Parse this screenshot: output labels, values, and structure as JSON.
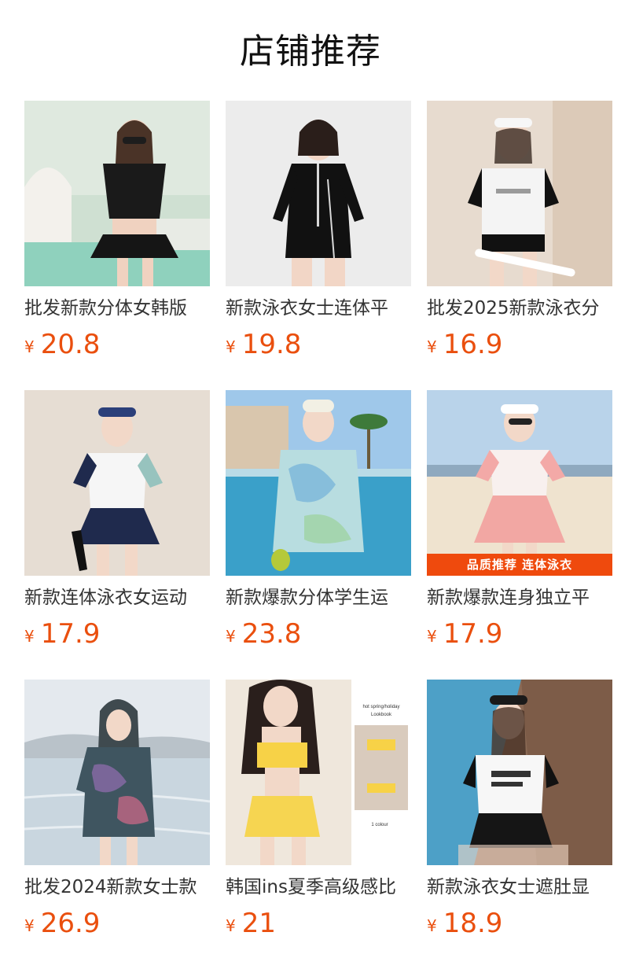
{
  "page": {
    "title": "店铺推荐"
  },
  "colors": {
    "price": "#ea4f0e",
    "badge_bg": "#ef4a0d",
    "title": "#111111",
    "name": "#333333"
  },
  "currency": "¥",
  "products": [
    {
      "name": "批发新款分体女韩版",
      "price": "20.8",
      "image_icon": "swimsuit-photo-black-skirt"
    },
    {
      "name": "新款泳衣女士连体平",
      "price": "19.8",
      "image_icon": "swimsuit-photo-black-zip-longsleeve"
    },
    {
      "name": "批发2025新款泳衣分",
      "price": "16.9",
      "image_icon": "swimsuit-photo-white-black-tee"
    },
    {
      "name": "新款连体泳衣女运动",
      "price": "17.9",
      "image_icon": "swimsuit-photo-navy-dress"
    },
    {
      "name": "新款爆款分体学生运",
      "price": "23.8",
      "image_icon": "swimsuit-photo-blue-print-pool"
    },
    {
      "name": "新款爆款连身独立平",
      "price": "17.9",
      "image_icon": "swimsuit-photo-pink-beach",
      "badge": "品质推荐 连体泳衣"
    },
    {
      "name": "批发2024新款女士款",
      "price": "26.9",
      "image_icon": "swimsuit-photo-floral-hoodie-sea"
    },
    {
      "name": "韩国ins夏季高级感比",
      "price": "21",
      "image_icon": "swimsuit-photo-yellow-bikini",
      "image_text": {
        "line1": "hot spring/holiday",
        "line2": "Lookbook",
        "caption": "1 colour"
      }
    },
    {
      "name": "新款泳衣女士遮肚显",
      "price": "18.9",
      "image_icon": "swimsuit-photo-white-tee-poolside"
    }
  ]
}
